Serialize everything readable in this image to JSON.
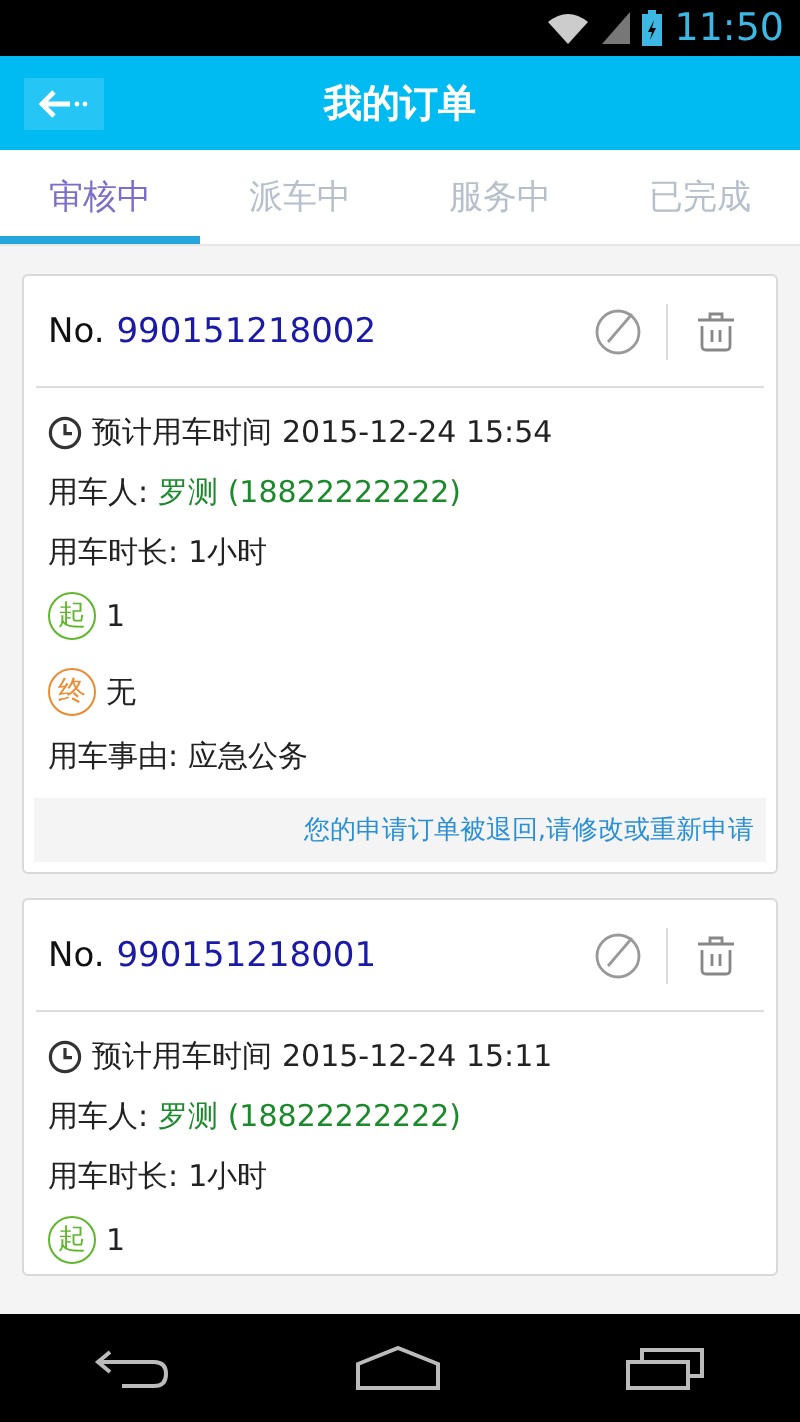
{
  "status_bar": {
    "time": "11:50"
  },
  "app_bar": {
    "title": "我的订单"
  },
  "tabs": [
    {
      "label": "审核中",
      "selected": true
    },
    {
      "label": "派车中",
      "selected": false
    },
    {
      "label": "服务中",
      "selected": false
    },
    {
      "label": "已完成",
      "selected": false
    }
  ],
  "orders": [
    {
      "number_label": "No.",
      "number": "990151218002",
      "scheduled_label": "预计用车时间",
      "scheduled_time": "2015-12-24 15:54",
      "passenger_label": "用车人:",
      "passenger": "罗测 (18822222222)",
      "duration_label": "用车时长:",
      "duration": "1小时",
      "start_badge": "起",
      "start": "1",
      "end_badge": "终",
      "end": "无",
      "reason_label": "用车事由:",
      "reason": "应急公务",
      "notice": "您的申请订单被退回,请修改或重新申请"
    },
    {
      "number_label": "No.",
      "number": "990151218001",
      "scheduled_label": "预计用车时间",
      "scheduled_time": "2015-12-24 15:11",
      "passenger_label": "用车人:",
      "passenger": "罗测 (18822222222)",
      "duration_label": "用车时长:",
      "duration": "1小时",
      "start_badge": "起",
      "start": "1"
    }
  ]
}
